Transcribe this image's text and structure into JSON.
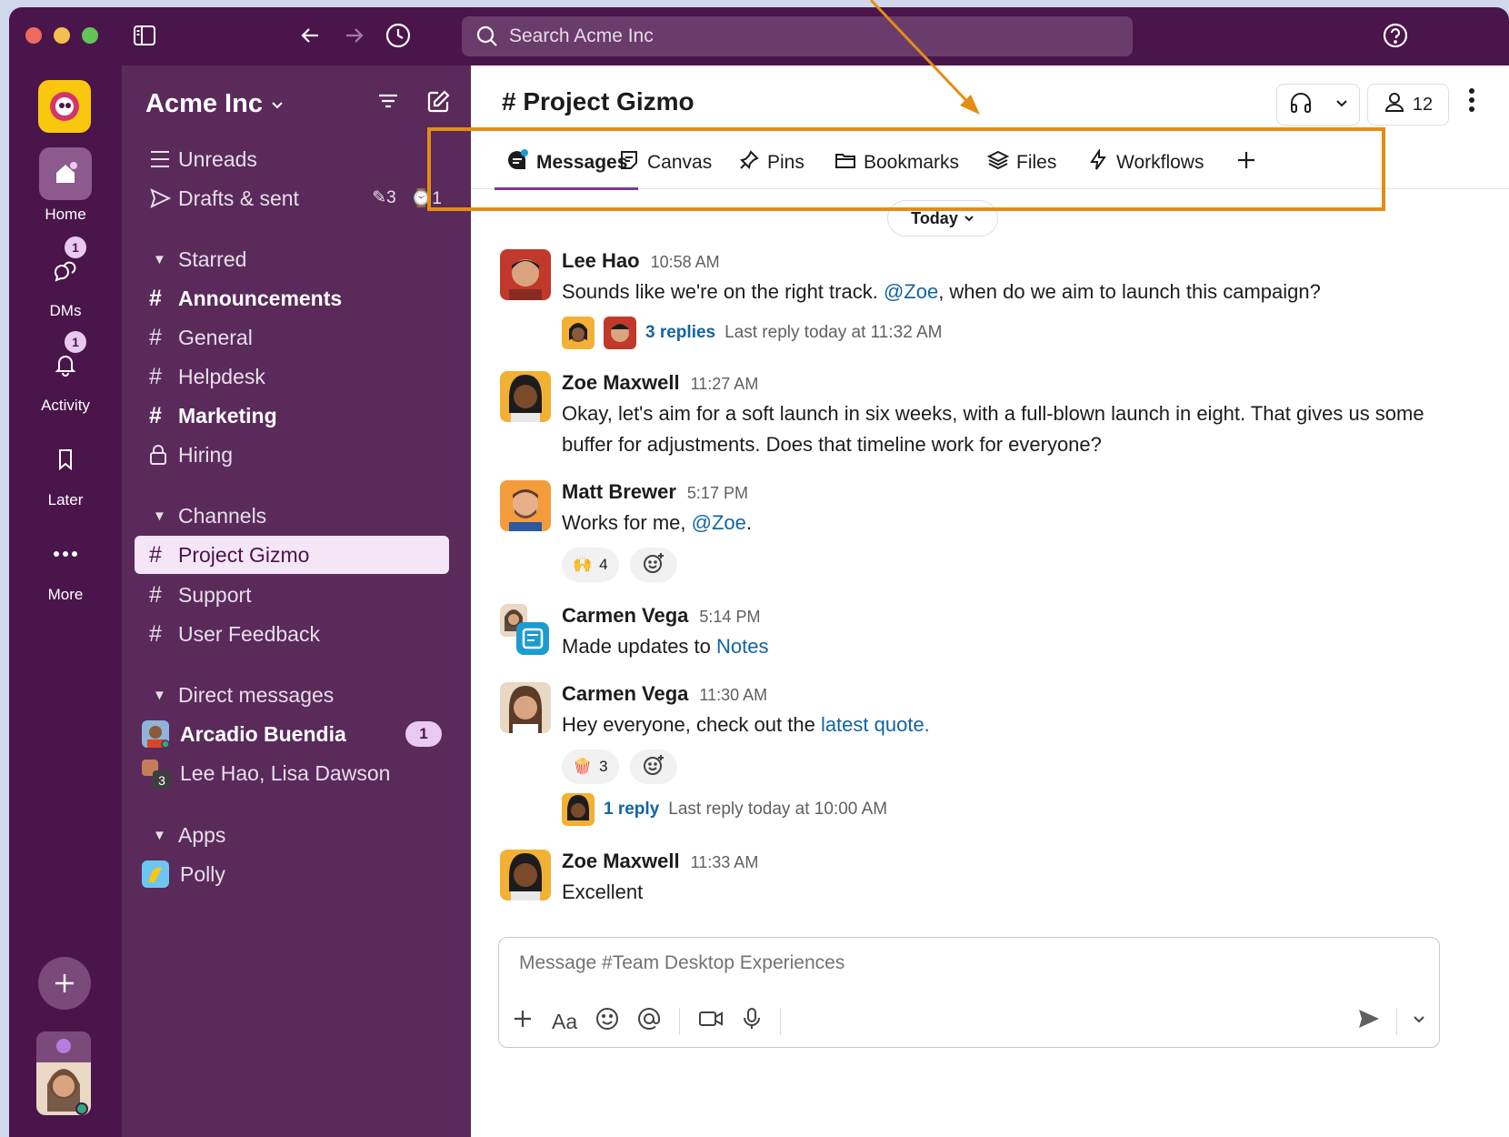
{
  "search": {
    "placeholder": "Search Acme Inc"
  },
  "rail": {
    "items": [
      {
        "label": "Home"
      },
      {
        "label": "DMs",
        "badge": "1"
      },
      {
        "label": "Activity",
        "badge": "1"
      },
      {
        "label": "Later"
      },
      {
        "label": "More"
      }
    ]
  },
  "sidebar": {
    "workspace": "Acme Inc",
    "unreads": "Unreads",
    "drafts": {
      "label": "Drafts & sent",
      "drafts_count": "3",
      "scheduled_count": "1"
    },
    "starred": {
      "label": "Starred",
      "channels": [
        {
          "name": "Announcements",
          "bold": true
        },
        {
          "name": "General",
          "bold": false
        },
        {
          "name": "Helpdesk",
          "bold": false
        },
        {
          "name": "Marketing",
          "bold": true
        },
        {
          "name": "Hiring",
          "bold": false,
          "private": true
        }
      ]
    },
    "channels": {
      "label": "Channels",
      "items": [
        {
          "name": "Project Gizmo",
          "selected": true
        },
        {
          "name": "Support"
        },
        {
          "name": "User Feedback"
        }
      ]
    },
    "dms": {
      "label": "Direct messages",
      "items": [
        {
          "name": "Arcadio Buendia",
          "badge": "1",
          "bold": true
        },
        {
          "name": "Lee Hao, Lisa Dawson",
          "group_count": "3"
        }
      ]
    },
    "apps": {
      "label": "Apps",
      "items": [
        {
          "name": "Polly"
        }
      ]
    }
  },
  "channel": {
    "title": "# Project Gizmo",
    "member_count": "12",
    "tabs": [
      {
        "label": "Messages",
        "icon": "message-icon"
      },
      {
        "label": "Canvas",
        "icon": "canvas-icon"
      },
      {
        "label": "Pins",
        "icon": "pin-icon"
      },
      {
        "label": "Bookmarks",
        "icon": "folder-icon"
      },
      {
        "label": "Files",
        "icon": "layers-icon"
      },
      {
        "label": "Workflows",
        "icon": "lightning-icon"
      }
    ],
    "day_divider": "Today"
  },
  "messages": [
    {
      "author": "Lee Hao",
      "time": "10:58 AM",
      "text_before": "Sounds like we're on the right track. ",
      "mention": "@Zoe",
      "text_after": ", when do we aim to launch this campaign?",
      "thread": {
        "replies": "3 replies",
        "last": "Last reply today at 11:32 AM"
      }
    },
    {
      "author": "Zoe Maxwell",
      "time": "11:27 AM",
      "text": "Okay, let's aim for a soft launch in six weeks, with a full-blown launch in eight. That gives us some buffer for adjustments. Does that timeline work for everyone?"
    },
    {
      "author": "Matt Brewer",
      "time": "5:17 PM",
      "text_before": "Works for me, ",
      "mention": "@Zoe",
      "text_after": ".",
      "reaction": {
        "emoji": "🙌",
        "count": "4"
      }
    },
    {
      "author": "Carmen Vega",
      "time": "5:14 PM",
      "text_before": "Made updates to ",
      "link": "Notes"
    },
    {
      "author": "Carmen Vega",
      "time": "11:30 AM",
      "text_before": "Hey everyone, check out the ",
      "link": "latest quote.",
      "reaction": {
        "emoji": "🍿",
        "count": "3"
      },
      "thread": {
        "replies": "1 reply",
        "last": "Last reply today at 10:00 AM"
      }
    },
    {
      "author": "Zoe Maxwell",
      "time": "11:33 AM",
      "text": "Excellent"
    }
  ],
  "composer": {
    "placeholder": "Message #Team Desktop Experiences",
    "format_label": "Aa"
  },
  "colors": {
    "aubergine": "#4a154b",
    "sidebar": "#5a2a5b",
    "link": "#1264a3",
    "highlight": "#e38d15"
  }
}
